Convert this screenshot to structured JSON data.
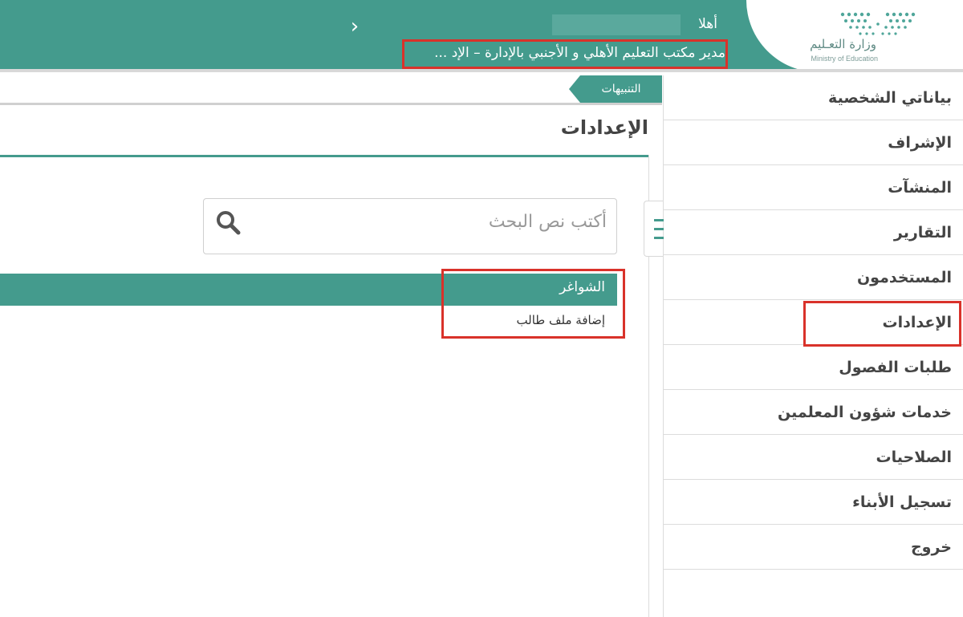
{
  "header": {
    "greeting": "أهلا",
    "role": "مدير مكتب التعليم الأهلي و الأجنبي بالإدارة – الإد ...",
    "logo_ar": "وزارة التعـليم",
    "logo_en": "Ministry of Education",
    "accent": "#449b8d",
    "highlight": "#d9322a"
  },
  "notifications": {
    "label": "التنبيهات"
  },
  "sidebar": {
    "items": [
      {
        "label": "بياناتي الشخصية"
      },
      {
        "label": "الإشراف"
      },
      {
        "label": "المنشآت"
      },
      {
        "label": "التقارير"
      },
      {
        "label": "المستخدمون"
      },
      {
        "label": "الإعدادات"
      },
      {
        "label": "طلبات الفصول"
      },
      {
        "label": "خدمات شؤون المعلمين"
      },
      {
        "label": "الصلاحيات"
      },
      {
        "label": "تسجيل الأبناء"
      },
      {
        "label": "خروج"
      }
    ]
  },
  "main": {
    "title": "الإعدادات",
    "search": {
      "placeholder": "أكتب نص البحث"
    },
    "group": {
      "label": "الشواغر",
      "items": [
        {
          "label": "إضافة ملف طالب"
        }
      ]
    }
  }
}
